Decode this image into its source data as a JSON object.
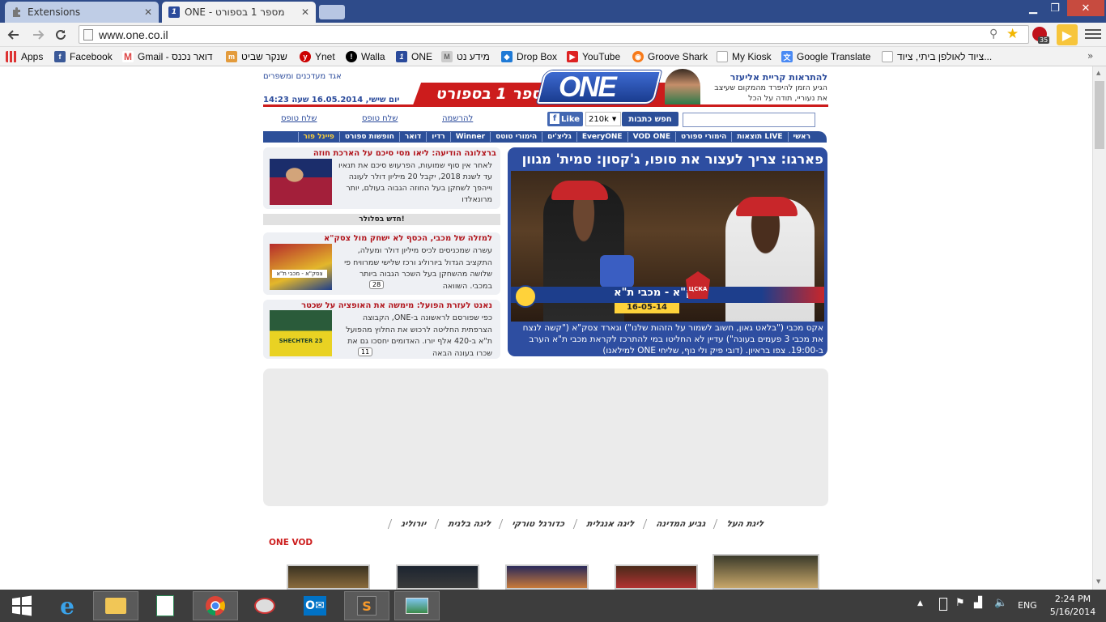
{
  "browser": {
    "tabs": [
      {
        "title": "Extensions"
      },
      {
        "title": "ONE - מספר 1 בספורט"
      }
    ],
    "url": "www.one.co.il",
    "badge": "35",
    "bookmarks": [
      "Apps",
      "Facebook",
      "Gmail - דואר נכנס",
      "שנקר שביט",
      "Ynet",
      "Walla",
      "ONE",
      "מידע נט",
      "Drop Box",
      "YouTube",
      "Groove Shark",
      "My Kiosk",
      "Google Translate",
      "ציוד לאולפן ביתי, ציוד..."
    ]
  },
  "site": {
    "top_link": "אגד מעדכנים ומשפרים",
    "logo_text": "ONE",
    "slogan": "מספר 1 בספורט",
    "promo_title": "להתראות קריית אליעזר",
    "promo_text": "הגיע הזמן להיפרד מהמקום שעיצב את נעוריי, תודה על הכל",
    "date_line": "יום שישי, 16.05.2014 שעה 14:23",
    "search_button": "חפש כתבות",
    "fb_like": "Like",
    "fb_count": "210k",
    "links": {
      "register": "להרשמה",
      "send_tip": "שלח טופס",
      "send_form": "שלח טופס"
    },
    "nav": [
      "ראשי",
      "תוצאות LIVE",
      "הימורי ספורט",
      "VOD ONE",
      "EveryONE",
      "גליצ'ים",
      "הימורי טוטס",
      "Winner",
      "רדיו",
      "דואר",
      "חופשות ספורט",
      "פיינל פור"
    ],
    "main_story": {
      "headline": "פארגו: צריך לעצור את סופו, ג'קסון: סמית' מגוון",
      "caption": "אקס מכבי (\"בלאט גאון, חשוב לשמור על הזהות שלנו\") וגארד צסק\"א (\"קשה לנצח את מכבי 3 פעמים בעונה\") עדיין לא החליטו במי להתרכז לקראת מכבי ת\"א הערב ב-19:00. צפו בראיון. (דובי פיק ולי נוף, שליחי ONE למילאנו)",
      "overlay_title": "צסק\"א - מכבי ת\"א",
      "overlay_date": "16-05-14",
      "team_badge": "ЦСКА"
    },
    "side_stories": [
      {
        "title": "ברצלונה הודיעה: ליאו מסי סיכם על הארכת חוזה",
        "text": "לאחר אין סוף שמועות, הפרעוש סיכם את תנאיו עד לשנת 2018, יקבל 20 מיליון דולר לעונה וייהפך לשחקן בעל החוזה הגבוה בעולם, יותר מרונאלדו"
      },
      {
        "title": "למזלה של מכבי, הכסף לא ישחק מול צסק\"א",
        "text": "עשרה שמכניסים לכיס מיליון דולר ומעלה, התקציב הגדול ביורוליג ורכז שלישי שמרוויח פי שלושה מהשחקן בעל השכר הגבוה ביותר במכבי. השוואה",
        "count": "28",
        "img_label": "צסק\"א - מכבי ת\"א"
      },
      {
        "title": "נאנט לעזרת הפועל: מימשה את האופציה על שכטר",
        "text": "כפי שפורסם לראשונה ב-ONE, הקבוצה הצרפתית החליטה לרכוש את החלוץ מהפועל ת\"א ב-420 אלף יורו. האדומים יחסכו גם את שכרו בעונה הבאה",
        "count": "11",
        "shirt": "SHECHTER 23"
      }
    ],
    "mobile_label": "חדש בסלולר!",
    "leagues": [
      "ליגת העל",
      "גביע המדינה",
      "ליגה אנגלית",
      "כדורגל טורקי",
      "ליגה בלגית",
      "יורוליג"
    ],
    "vod_label": "ONE VOD"
  },
  "taskbar": {
    "lang": "ENG",
    "time": "2:24 PM",
    "date": "5/16/2014"
  },
  "colors": {
    "red": "#cc1c1c",
    "blue": "#2a4a9b",
    "nav_blue": "#2c4f99"
  }
}
